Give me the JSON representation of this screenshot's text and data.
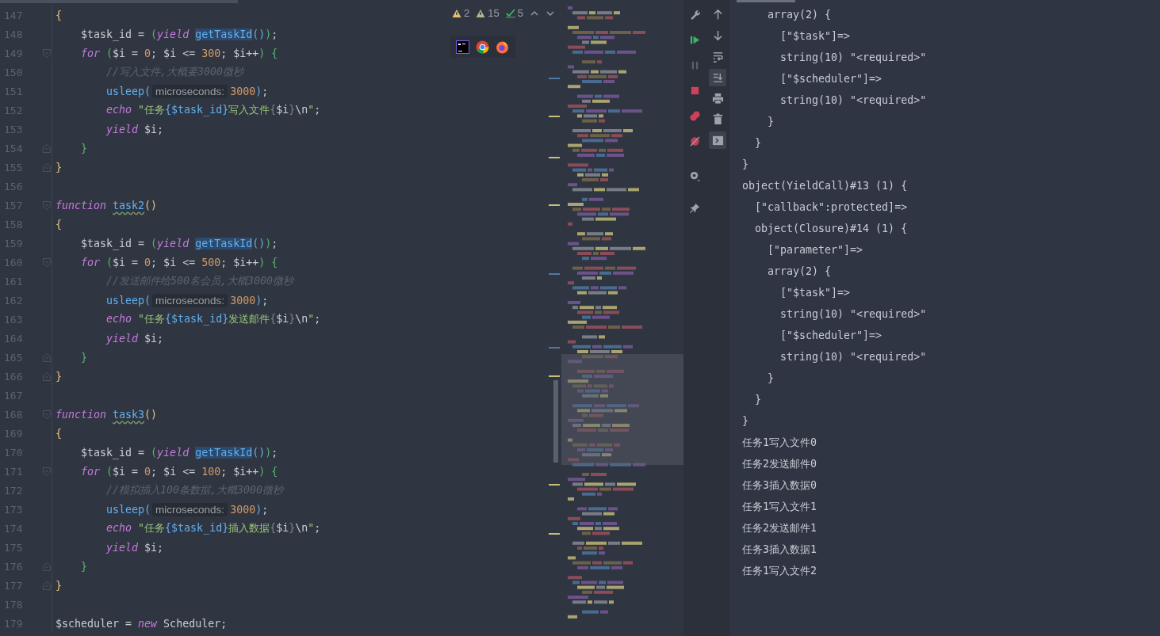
{
  "editor": {
    "inspections": [
      {
        "kind": "warning",
        "count": "2"
      },
      {
        "kind": "weak-warning",
        "count": "15"
      },
      {
        "kind": "typo",
        "count": "5"
      }
    ],
    "lines": [
      {
        "number": "147",
        "fold_start": false,
        "fold_end": false,
        "tokens": [
          {
            "text": "{",
            "kind": "brace"
          }
        ]
      },
      {
        "number": "148",
        "fold_start": false,
        "fold_end": false,
        "tokens": [
          {
            "text": "    $task_id = ",
            "kind": "p"
          },
          {
            "text": "(",
            "kind": "paren"
          },
          {
            "text": "yield ",
            "kind": "kw"
          },
          {
            "text": "getTaskId",
            "kind": "sel"
          },
          {
            "text": "()",
            "kind": "fn"
          },
          {
            "text": ")",
            "kind": "paren"
          },
          {
            "text": ";",
            "kind": "p"
          }
        ]
      },
      {
        "number": "149",
        "fold_start": true,
        "fold_end": false,
        "tokens": [
          {
            "text": "    for ",
            "kind": "kw"
          },
          {
            "text": "(",
            "kind": "paren"
          },
          {
            "text": "$i = ",
            "kind": "p"
          },
          {
            "text": "0",
            "kind": "num"
          },
          {
            "text": "; $i <= ",
            "kind": "p"
          },
          {
            "text": "300",
            "kind": "num"
          },
          {
            "text": "; $i++",
            "kind": "p"
          },
          {
            "text": ") {",
            "kind": "paren"
          }
        ]
      },
      {
        "number": "150",
        "fold_start": false,
        "fold_end": false,
        "tokens": [
          {
            "text": "        //写入文件,大概要3000微秒",
            "kind": "cmt"
          }
        ]
      },
      {
        "number": "151",
        "fold_start": false,
        "fold_end": false,
        "tokens": [
          {
            "text": "        usleep(",
            "kind": "fn"
          },
          {
            "text": "microseconds:",
            "kind": "hint"
          },
          {
            "text": "3000",
            "kind": "num"
          },
          {
            "text": ")",
            "kind": "fn"
          },
          {
            "text": ";",
            "kind": "p"
          }
        ]
      },
      {
        "number": "152",
        "fold_start": false,
        "fold_end": false,
        "tokens": [
          {
            "text": "        echo ",
            "kind": "kw"
          },
          {
            "text": "\"任务",
            "kind": "str"
          },
          {
            "text": "{$task_id}",
            "kind": "strvar"
          },
          {
            "text": "写入文件",
            "kind": "str"
          },
          {
            "text": "{",
            "kind": "dim"
          },
          {
            "text": "$i",
            "kind": "p"
          },
          {
            "text": "}",
            "kind": "dim"
          },
          {
            "text": "\\n",
            "kind": "p"
          },
          {
            "text": "\"",
            "kind": "str"
          },
          {
            "text": ";",
            "kind": "p"
          }
        ]
      },
      {
        "number": "153",
        "fold_start": false,
        "fold_end": false,
        "tokens": [
          {
            "text": "        yield",
            "kind": "kw"
          },
          {
            "text": " $i;",
            "kind": "p"
          }
        ]
      },
      {
        "number": "154",
        "fold_start": false,
        "fold_end": true,
        "tokens": [
          {
            "text": "    }",
            "kind": "paren"
          }
        ]
      },
      {
        "number": "155",
        "fold_start": false,
        "fold_end": true,
        "tokens": [
          {
            "text": "}",
            "kind": "brace"
          }
        ]
      },
      {
        "number": "156",
        "fold_start": false,
        "fold_end": false
      },
      {
        "number": "157",
        "fold_start": true,
        "fold_end": false,
        "tokens": [
          {
            "text": "function ",
            "kind": "kw"
          },
          {
            "text": "task2",
            "kind": "def"
          },
          {
            "text": "()",
            "kind": "brace"
          }
        ]
      },
      {
        "number": "158",
        "fold_start": false,
        "fold_end": false,
        "tokens": [
          {
            "text": "{",
            "kind": "brace"
          }
        ]
      },
      {
        "number": "159",
        "fold_start": false,
        "fold_end": false,
        "tokens": [
          {
            "text": "    $task_id = ",
            "kind": "p"
          },
          {
            "text": "(",
            "kind": "paren"
          },
          {
            "text": "yield ",
            "kind": "kw"
          },
          {
            "text": "getTaskId",
            "kind": "sel"
          },
          {
            "text": "()",
            "kind": "fn"
          },
          {
            "text": ")",
            "kind": "paren"
          },
          {
            "text": ";",
            "kind": "p"
          }
        ]
      },
      {
        "number": "160",
        "fold_start": true,
        "fold_end": false,
        "tokens": [
          {
            "text": "    for ",
            "kind": "kw"
          },
          {
            "text": "(",
            "kind": "paren"
          },
          {
            "text": "$i = ",
            "kind": "p"
          },
          {
            "text": "0",
            "kind": "num"
          },
          {
            "text": "; $i <= ",
            "kind": "p"
          },
          {
            "text": "500",
            "kind": "num"
          },
          {
            "text": "; $i++",
            "kind": "p"
          },
          {
            "text": ") {",
            "kind": "paren"
          }
        ]
      },
      {
        "number": "161",
        "fold_start": false,
        "fold_end": false,
        "tokens": [
          {
            "text": "        //发送邮件给500名会员,大概3000微秒",
            "kind": "cmt"
          }
        ]
      },
      {
        "number": "162",
        "fold_start": false,
        "fold_end": false,
        "tokens": [
          {
            "text": "        usleep(",
            "kind": "fn"
          },
          {
            "text": "microseconds:",
            "kind": "hint"
          },
          {
            "text": "3000",
            "kind": "num"
          },
          {
            "text": ")",
            "kind": "fn"
          },
          {
            "text": ";",
            "kind": "p"
          }
        ]
      },
      {
        "number": "163",
        "fold_start": false,
        "fold_end": false,
        "tokens": [
          {
            "text": "        echo ",
            "kind": "kw"
          },
          {
            "text": "\"任务",
            "kind": "str"
          },
          {
            "text": "{$task_id}",
            "kind": "strvar"
          },
          {
            "text": "发送邮件",
            "kind": "str"
          },
          {
            "text": "{",
            "kind": "dim"
          },
          {
            "text": "$i",
            "kind": "p"
          },
          {
            "text": "}",
            "kind": "dim"
          },
          {
            "text": "\\n",
            "kind": "p"
          },
          {
            "text": "\"",
            "kind": "str"
          },
          {
            "text": ";",
            "kind": "p"
          }
        ]
      },
      {
        "number": "164",
        "fold_start": false,
        "fold_end": false,
        "tokens": [
          {
            "text": "        yield",
            "kind": "kw"
          },
          {
            "text": " $i;",
            "kind": "p"
          }
        ]
      },
      {
        "number": "165",
        "fold_start": false,
        "fold_end": true,
        "tokens": [
          {
            "text": "    }",
            "kind": "paren"
          }
        ]
      },
      {
        "number": "166",
        "fold_start": false,
        "fold_end": true,
        "tokens": [
          {
            "text": "}",
            "kind": "brace"
          }
        ]
      },
      {
        "number": "167",
        "fold_start": false,
        "fold_end": false
      },
      {
        "number": "168",
        "fold_start": true,
        "fold_end": false,
        "tokens": [
          {
            "text": "function ",
            "kind": "kw"
          },
          {
            "text": "task3",
            "kind": "def"
          },
          {
            "text": "()",
            "kind": "brace"
          }
        ]
      },
      {
        "number": "169",
        "fold_start": false,
        "fold_end": false,
        "tokens": [
          {
            "text": "{",
            "kind": "brace"
          }
        ]
      },
      {
        "number": "170",
        "fold_start": false,
        "fold_end": false,
        "tokens": [
          {
            "text": "    $task_id = ",
            "kind": "p"
          },
          {
            "text": "(",
            "kind": "paren"
          },
          {
            "text": "yield ",
            "kind": "kw"
          },
          {
            "text": "getTaskId",
            "kind": "sel"
          },
          {
            "text": "()",
            "kind": "fn"
          },
          {
            "text": ")",
            "kind": "paren"
          },
          {
            "text": ";",
            "kind": "p"
          }
        ]
      },
      {
        "number": "171",
        "fold_start": true,
        "fold_end": false,
        "tokens": [
          {
            "text": "    for ",
            "kind": "kw"
          },
          {
            "text": "(",
            "kind": "paren"
          },
          {
            "text": "$i = ",
            "kind": "p"
          },
          {
            "text": "0",
            "kind": "num"
          },
          {
            "text": "; $i <= ",
            "kind": "p"
          },
          {
            "text": "100",
            "kind": "num"
          },
          {
            "text": "; $i++",
            "kind": "p"
          },
          {
            "text": ") {",
            "kind": "paren"
          }
        ]
      },
      {
        "number": "172",
        "fold_start": false,
        "fold_end": false,
        "tokens": [
          {
            "text": "        //模拟插入100条数据,大概3000微秒",
            "kind": "cmt"
          }
        ]
      },
      {
        "number": "173",
        "fold_start": false,
        "fold_end": false,
        "tokens": [
          {
            "text": "        usleep(",
            "kind": "fn"
          },
          {
            "text": "microseconds:",
            "kind": "hint"
          },
          {
            "text": "3000",
            "kind": "num"
          },
          {
            "text": ")",
            "kind": "fn"
          },
          {
            "text": ";",
            "kind": "p"
          }
        ]
      },
      {
        "number": "174",
        "fold_start": false,
        "fold_end": false,
        "tokens": [
          {
            "text": "        echo ",
            "kind": "kw"
          },
          {
            "text": "\"任务",
            "kind": "str"
          },
          {
            "text": "{$task_id}",
            "kind": "strvar"
          },
          {
            "text": "插入数据",
            "kind": "str"
          },
          {
            "text": "{",
            "kind": "dim"
          },
          {
            "text": "$i",
            "kind": "p"
          },
          {
            "text": "}",
            "kind": "dim"
          },
          {
            "text": "\\n",
            "kind": "p"
          },
          {
            "text": "\"",
            "kind": "str"
          },
          {
            "text": ";",
            "kind": "p"
          }
        ]
      },
      {
        "number": "175",
        "fold_start": false,
        "fold_end": false,
        "tokens": [
          {
            "text": "        yield",
            "kind": "kw"
          },
          {
            "text": " $i;",
            "kind": "p"
          }
        ]
      },
      {
        "number": "176",
        "fold_start": false,
        "fold_end": true,
        "tokens": [
          {
            "text": "    }",
            "kind": "paren"
          }
        ]
      },
      {
        "number": "177",
        "fold_start": false,
        "fold_end": true,
        "tokens": [
          {
            "text": "}",
            "kind": "brace"
          }
        ]
      },
      {
        "number": "178",
        "fold_start": false,
        "fold_end": false
      },
      {
        "number": "179",
        "fold_start": false,
        "fold_end": false,
        "tokens": [
          {
            "text": "$scheduler = ",
            "kind": "p"
          },
          {
            "text": "new",
            "kind": "kw"
          },
          {
            "text": " Scheduler;",
            "kind": "p"
          }
        ]
      }
    ]
  },
  "run_toolbar": [
    {
      "kind": "wrench",
      "disabled": false
    },
    {
      "kind": "rerun",
      "disabled": false
    },
    {
      "kind": "pause",
      "disabled": true
    },
    {
      "kind": "stop",
      "disabled": false
    },
    {
      "kind": "breakpoints",
      "disabled": false
    },
    {
      "kind": "mute",
      "disabled": false
    },
    {
      "kind": "settings",
      "disabled": false
    },
    {
      "kind": "pin",
      "disabled": false
    }
  ],
  "console_toolbar": [
    {
      "kind": "up",
      "toggled": false
    },
    {
      "kind": "down",
      "toggled": false
    },
    {
      "kind": "wrap",
      "toggled": false
    },
    {
      "kind": "scroll-end",
      "toggled": true
    },
    {
      "kind": "print",
      "toggled": false
    },
    {
      "kind": "trash",
      "toggled": false
    },
    {
      "kind": "console",
      "toggled": true
    }
  ],
  "console": {
    "lines": [
      "    array(2) {",
      "      [\"$task\"]=>",
      "      string(10) \"<required>\"",
      "      [\"$scheduler\"]=>",
      "      string(10) \"<required>\"",
      "    }",
      "  }",
      "}",
      "object(YieldCall)#13 (1) {",
      "  [\"callback\":protected]=>",
      "  object(Closure)#14 (1) {",
      "    [\"parameter\"]=>",
      "    array(2) {",
      "      [\"$task\"]=>",
      "      string(10) \"<required>\"",
      "      [\"$scheduler\"]=>",
      "      string(10) \"<required>\"",
      "    }",
      "  }",
      "}",
      "任务1写入文件0",
      "任务2发送邮件0",
      "任务3插入数据0",
      "任务1写入文件1",
      "任务2发送邮件1",
      "任务3插入数据1",
      "任务1写入文件2"
    ]
  }
}
